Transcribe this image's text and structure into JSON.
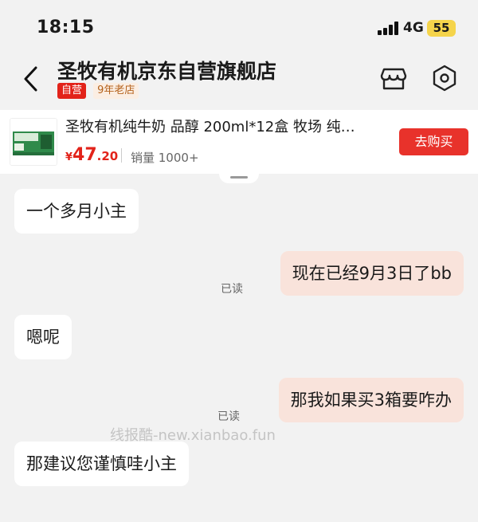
{
  "status_bar": {
    "time": "18:15",
    "network": "4G",
    "battery": "55"
  },
  "header": {
    "store_name": "圣牧有机京东自营旗舰店",
    "badge_self": "自营",
    "badge_age": "9年老店"
  },
  "product": {
    "title": "圣牧有机纯牛奶 品醇 200ml*12盒 牧场 纯…",
    "price_symbol": "¥",
    "price_int": "47",
    "price_dec": ".20",
    "sales": "销量 1000+",
    "buy_label": "去购买"
  },
  "messages": [
    {
      "side": "incoming",
      "text": "一个多月小主"
    },
    {
      "side": "outgoing",
      "text": "现在已经9月3日了bb",
      "status": "已读"
    },
    {
      "side": "incoming",
      "text": "嗯呢"
    },
    {
      "side": "outgoing",
      "text": "那我如果买3箱要咋办",
      "status": "已读"
    },
    {
      "side": "incoming",
      "text": "那建议您谨慎哇小主"
    }
  ],
  "watermark": "线报酷-new.xianbao.fun",
  "colors": {
    "accent": "#e2231a",
    "outgoing_bubble": "#f9e3db",
    "background": "#f2f2f2",
    "battery": "#f5d44b"
  },
  "icons": [
    "back-chevron-icon",
    "store-icon",
    "settings-hexagon-icon"
  ]
}
